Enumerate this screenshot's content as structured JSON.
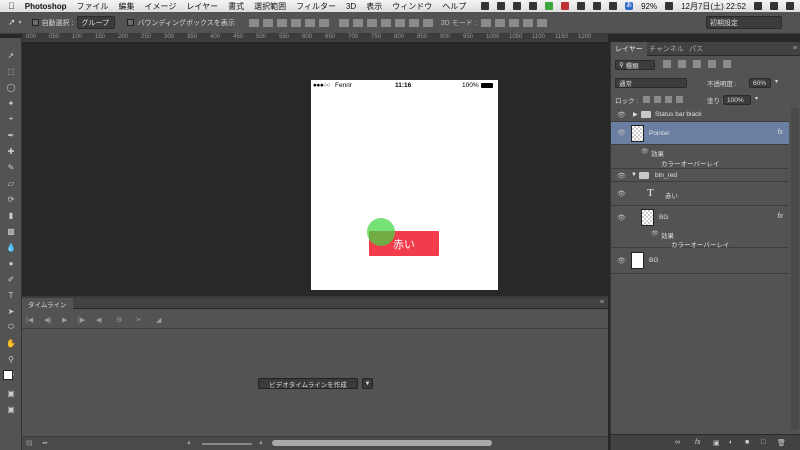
{
  "menubar": {
    "apple": "",
    "app": "Photoshop",
    "items": [
      "ファイル",
      "編集",
      "イメージ",
      "レイヤー",
      "書式",
      "選択範囲",
      "フィルター",
      "3D",
      "表示",
      "ウィンドウ",
      "ヘルプ"
    ],
    "battery": "92%",
    "clock": "12月7日(土)  22:52",
    "input_badge": "あ"
  },
  "options": {
    "auto_select": "自動選択 :",
    "group": "グループ",
    "bbox": "バウンディングボックスを表示",
    "mode3d": "3D モード :",
    "workspace": "初期設定"
  },
  "ruler": [
    "000",
    "050",
    "100",
    "150",
    "200",
    "250",
    "300",
    "350",
    "400",
    "450",
    "500",
    "550",
    "600",
    "650",
    "700",
    "750",
    "800",
    "850",
    "900",
    "950",
    "1000",
    "1050",
    "1100",
    "1150",
    "1200"
  ],
  "document": {
    "status": {
      "dots": "●●●○○",
      "carrier": "Fenrir",
      "time": "11:16",
      "battery": "100%"
    },
    "button_label": "赤い"
  },
  "timeline": {
    "tab": "タイムライン",
    "create_button": "ビデオタイムラインを作成",
    "arrow": "▼"
  },
  "panel": {
    "tabs": [
      "レイヤー",
      "チャンネル",
      "パス"
    ],
    "kind_filter": "種類",
    "blend_mode": "通常",
    "opacity_label": "不透明度 :",
    "opacity_value": "60%",
    "lock_label": "ロック :",
    "fill_label": "塗り :",
    "fill_value": "100%",
    "layers": [
      {
        "name": "Status bar black"
      },
      {
        "name": "Pointer",
        "effects": "効果",
        "effect": "カラーオーバーレイ"
      },
      {
        "name": "btn_red"
      },
      {
        "name": "赤い"
      },
      {
        "name": "BG",
        "effects": "効果",
        "effect": "カラーオーバーレイ"
      },
      {
        "name": "BG"
      }
    ]
  },
  "colors": {
    "accent_selected": "#6b7fa3",
    "button_red": "#f13c4c",
    "pointer_green": "#41d741"
  }
}
